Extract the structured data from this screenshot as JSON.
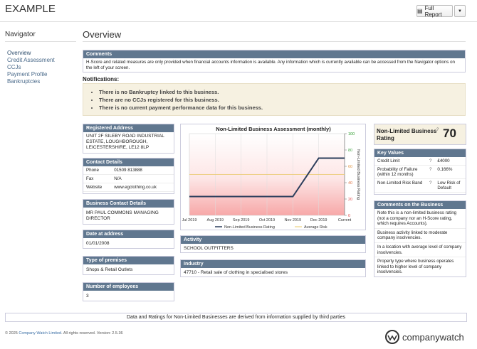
{
  "header": {
    "title": "EXAMPLE",
    "full_report_label": "Full Report"
  },
  "navigator": {
    "title": "Navigator",
    "items": [
      "Overview",
      "Credit Assessment",
      "CCJs",
      "Payment Profile",
      "Bankruptcies"
    ]
  },
  "overview": {
    "title": "Overview"
  },
  "comments": {
    "header": "Comments",
    "text": "H-Score and related measures are only provided when financial accounts information is available. Any information which is currently available can be accessed from the Navigator options on the left of your screen."
  },
  "notifications": {
    "title": "Notifications:",
    "items": [
      "There is no Bankruptcy linked to this business.",
      "There are no CCJs registered for this business.",
      "There is no current payment performance data for this business."
    ]
  },
  "registered_address": {
    "header": "Registered Address",
    "text": "UNIT 2F SILEBY ROAD INDUSTRIAL ESTATE, LOUGHBOROUGH, LEICESTERSHIRE, LE12 8LP"
  },
  "contact_details": {
    "header": "Contact Details",
    "rows": [
      {
        "k": "Phone",
        "v": "01509 813888"
      },
      {
        "k": "Fax",
        "v": "N/A"
      },
      {
        "k": "Website",
        "v": "www.egclothing.co.uk"
      }
    ]
  },
  "business_contact": {
    "header": "Business Contact Details",
    "text": "MR PAUL COMMONS MANAGING DIRECTOR"
  },
  "date_at_address": {
    "header": "Date at address",
    "text": "01/01/2008"
  },
  "type_of_premises": {
    "header": "Type of premises",
    "text": "Shops & Retail Outlets"
  },
  "employees": {
    "header": "Number of employees",
    "text": "3"
  },
  "activity": {
    "header": "Activity",
    "text": "SCHOOL OUTFITTERS"
  },
  "industry": {
    "header": "Industry",
    "text": "47710 - Retail sale of clothing in specialised stores"
  },
  "rating": {
    "label": "Non-Limited Business Rating",
    "q": "?",
    "value": "70"
  },
  "key_values": {
    "header": "Key Values",
    "rows": [
      {
        "k": "Credit Limit",
        "q": "?",
        "v": "£4000"
      },
      {
        "k": "Probability of Failure (within 12 months)",
        "q": "?",
        "v": "0.166%"
      },
      {
        "k": "Non-Limited Risk Band",
        "q": "?",
        "v": "Low Risk of Default"
      }
    ]
  },
  "business_comments": {
    "header": "Comments on the Business",
    "items": [
      "Note this is a non-limited business rating (not a company nor an H-Score rating, which requires Accounts).",
      "Business activity linked to moderate company insolvencies.",
      "In a location with average level of company insolvencies.",
      "Property type where business operates linked to higher level of company insolvencies."
    ]
  },
  "footer": {
    "note": "Data and Ratings for Non-Limited Businesses are derived from information supplied by third parties",
    "copyright_prefix": "© 2025",
    "copyright_link": "Company Watch Limited",
    "copyright_suffix": ". All rights reserved. Version: 2.5.36",
    "logo_text": "companywatch"
  },
  "chart_data": {
    "type": "line",
    "title": "Non-Limited Business Assessment (monthly)",
    "ylabel": "Non-Limited Business Rating",
    "categories": [
      "Jul 2019",
      "Aug 2019",
      "Sep 2019",
      "Oct 2019",
      "Nov 2019",
      "Dec 2019",
      "Current"
    ],
    "series": [
      {
        "name": "Non-Limited Business Rating",
        "values": [
          23,
          23,
          23,
          23,
          23,
          70,
          70
        ],
        "color": "#2c3e5c"
      },
      {
        "name": "Average Risk",
        "values": [
          50,
          50,
          50,
          50,
          50,
          50,
          50
        ],
        "color": "#e8c86a"
      }
    ],
    "y_ticks": [
      0,
      20,
      40,
      60,
      80,
      100
    ],
    "y_tick_colors": [
      "#e04848",
      "#e04848",
      "#e07848",
      "#e09848",
      "#48a848",
      "#2a9a2a"
    ],
    "ylim": [
      0,
      100
    ],
    "legend": "bottom"
  }
}
